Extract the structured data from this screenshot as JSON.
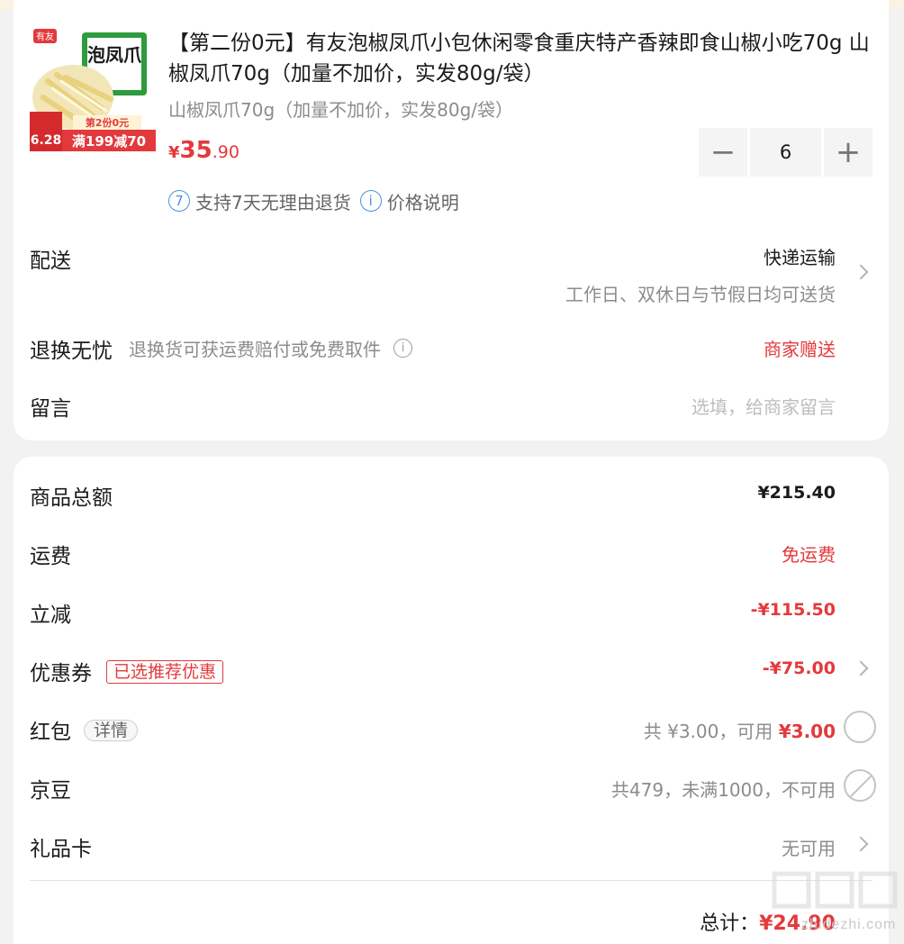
{
  "product": {
    "title": "【第二份0元】有友泡椒凤爪小包休闲零食重庆特产香辣即食山椒小吃70g 山椒凤爪70g（加量不加价，实发80g/袋）",
    "sku": "山椒凤爪70g（加量不加价，实发80g/袋）",
    "price_currency": "¥",
    "price_int": "35",
    "price_dec": ".90",
    "quantity": "6",
    "minus_label": "−",
    "plus_label": "+",
    "service_return": "支持7天无理由退货",
    "service_return_icon_text": "7",
    "service_price": "价格说明",
    "image_brand": "有友",
    "image_badge1": "第2份0元",
    "image_badge2": "满199减70",
    "image_date": "6.28",
    "image_pkg": "泡凤爪"
  },
  "delivery": {
    "label": "配送",
    "method": "快递运输",
    "detail": "工作日、双休日与节假日均可送货"
  },
  "return_row": {
    "label": "退换无忧",
    "hint": "退换货可获运费赔付或免费取件",
    "value": "商家赠送"
  },
  "message": {
    "label": "留言",
    "placeholder": "选填，给商家留言"
  },
  "summary": {
    "goods_total_label": "商品总额",
    "goods_total": "¥215.40",
    "shipping_label": "运费",
    "shipping": "免运费",
    "discount_label": "立减",
    "discount": "-¥115.50",
    "coupon_label": "优惠券",
    "coupon_tag": "已选推荐优惠",
    "coupon": "-¥75.00",
    "redpacket_label": "红包",
    "redpacket_tag": "详情",
    "redpacket_prefix": "共 ¥3.00，可用 ",
    "redpacket_available": "¥3.00",
    "jingdou_label": "京豆",
    "jingdou": "共479，未满1000，不可用",
    "giftcard_label": "礼品卡",
    "giftcard": "无可用",
    "total_label": "总计：",
    "total": "¥24.90"
  },
  "watermark": {
    "text": "zhidezhi.com"
  },
  "colors": {
    "accent_red": "#e4393c",
    "service_blue": "#4a90e2"
  }
}
